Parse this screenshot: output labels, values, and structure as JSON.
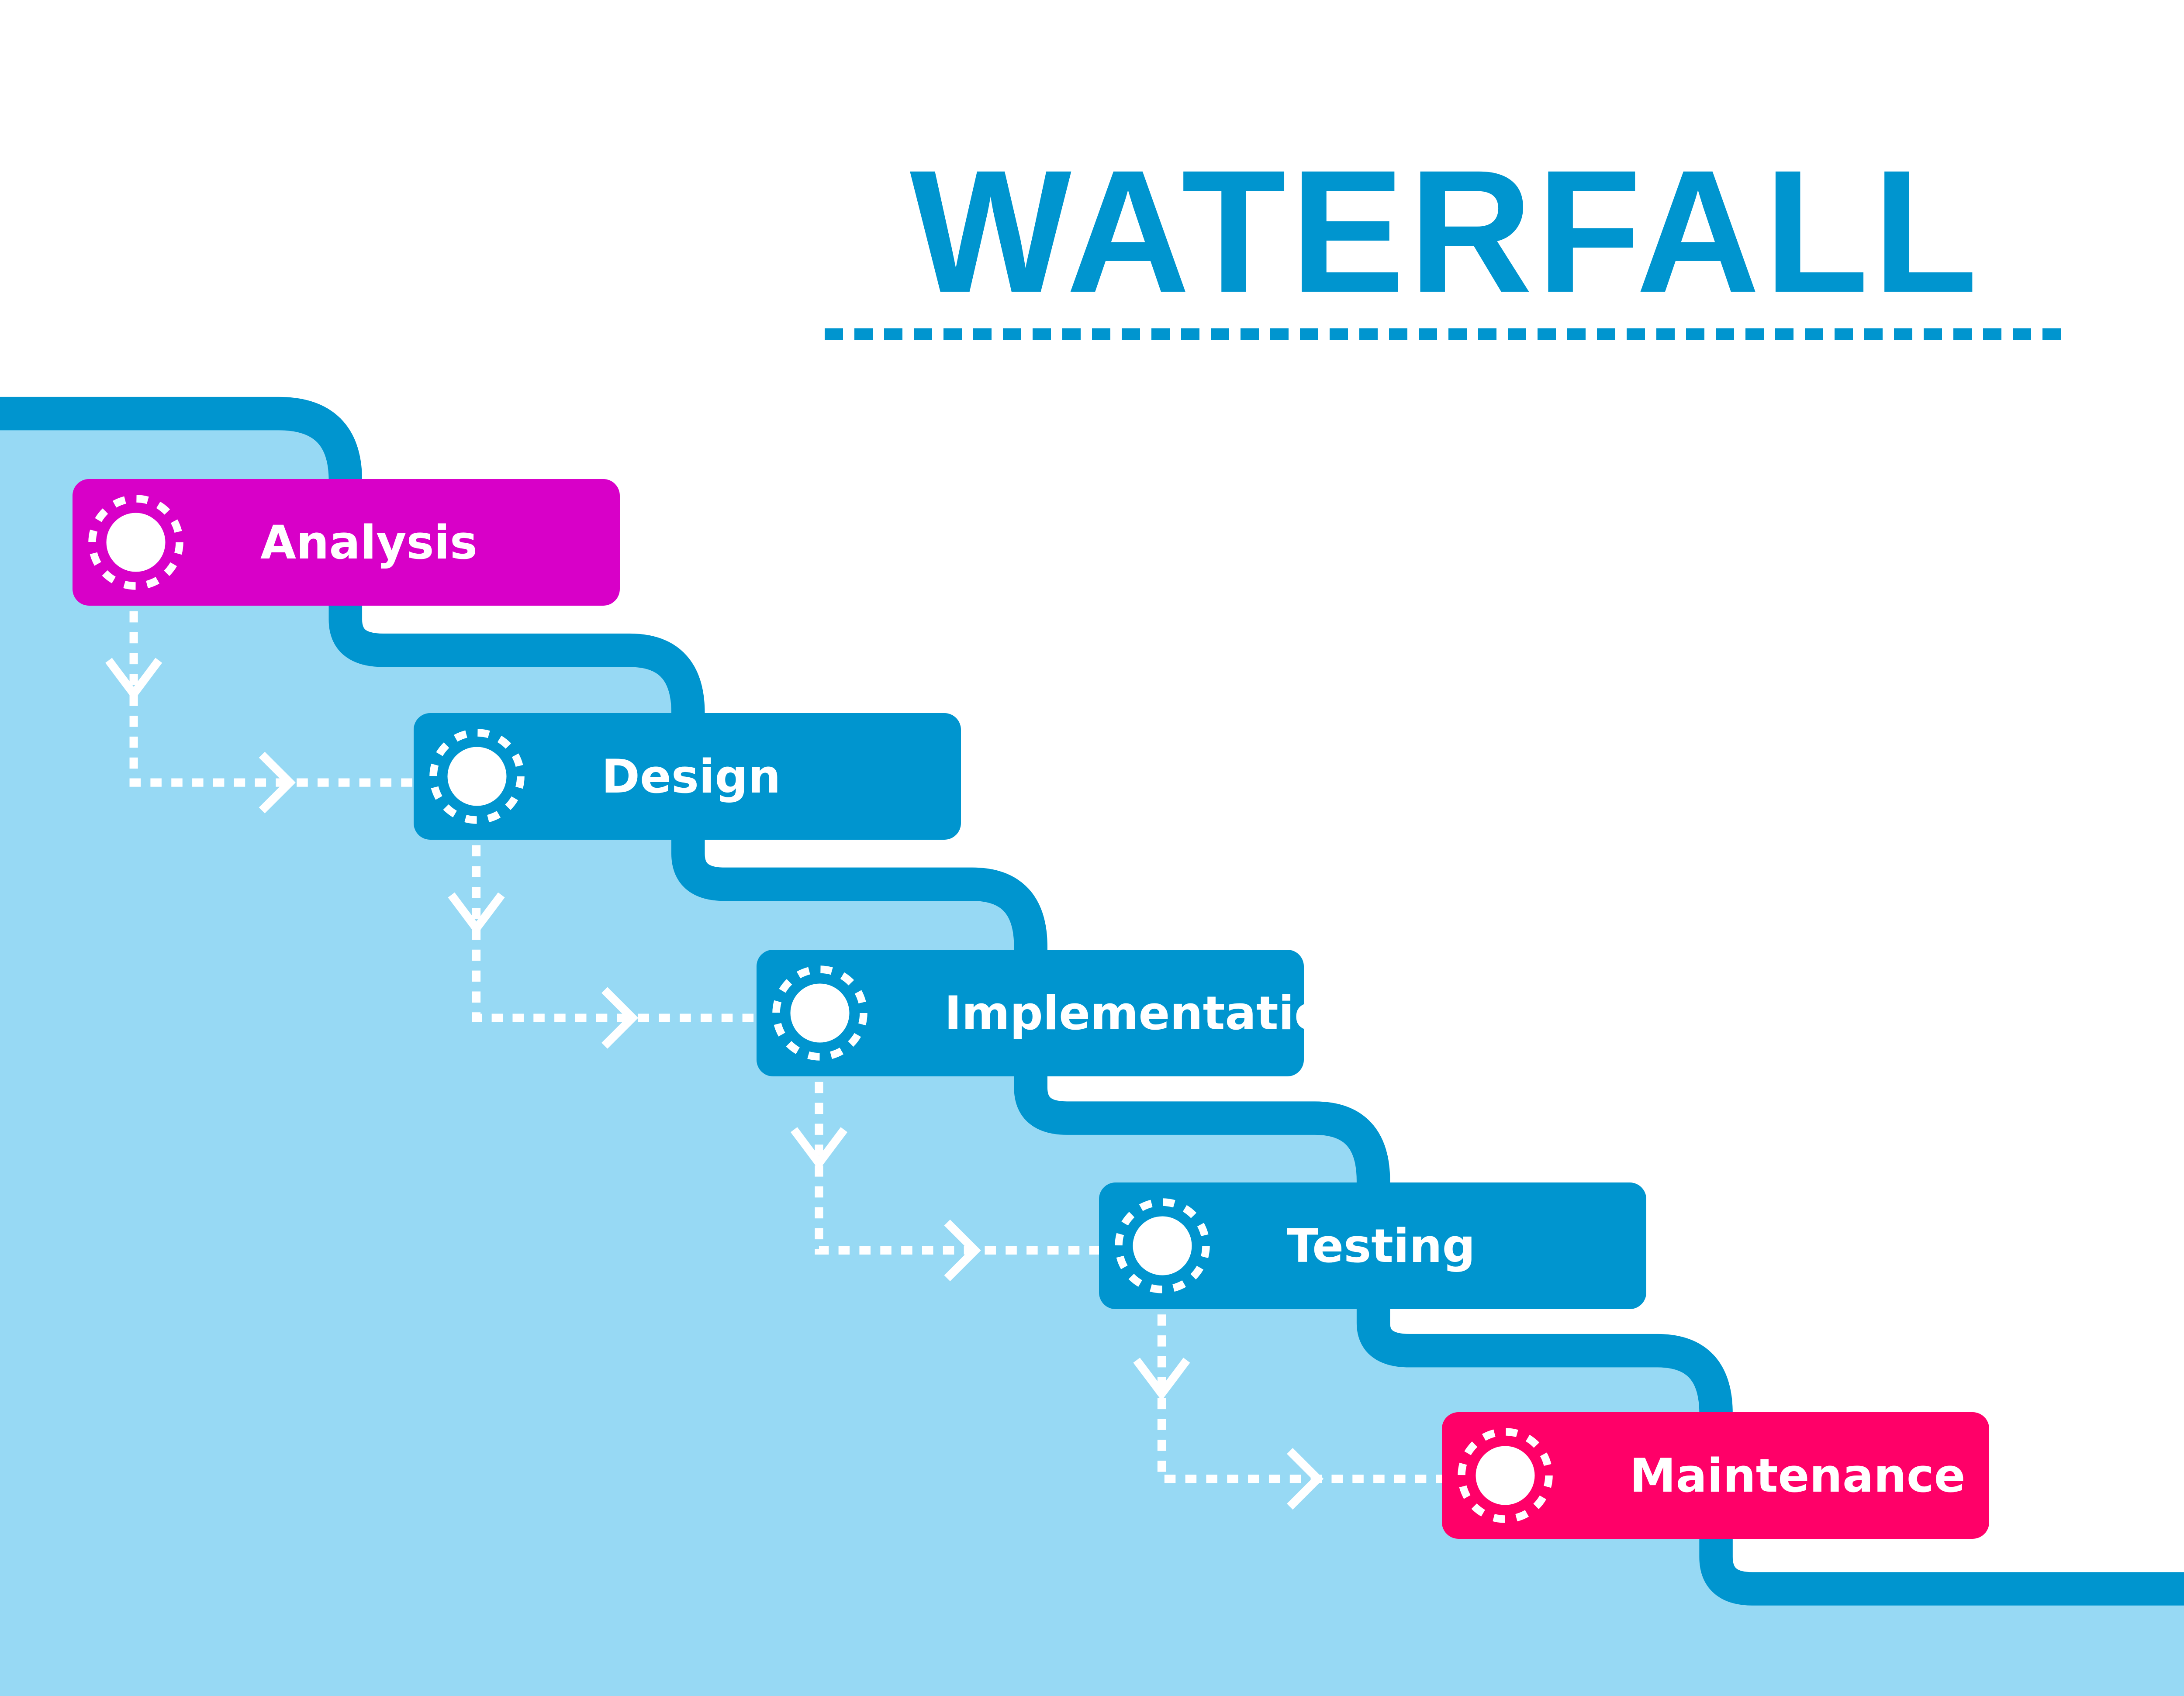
{
  "title": "WATERFALL",
  "colors": {
    "channel": "#0095cf",
    "water": "#97d9f4",
    "background": "#ffffff",
    "text_on_box": "#ffffff"
  },
  "phases": [
    {
      "label": "Analysis",
      "color": "#d800c8",
      "icon": "gear-icon"
    },
    {
      "label": "Design",
      "color": "#0095cf",
      "icon": "gear-icon"
    },
    {
      "label": "Implementation",
      "color": "#0095cf",
      "icon": "gear-icon"
    },
    {
      "label": "Testing",
      "color": "#0095cf",
      "icon": "gear-icon"
    },
    {
      "label": "Maintenance",
      "color": "#ff0068",
      "icon": "gear-icon"
    }
  ],
  "connectors": [
    {
      "from": "Analysis",
      "to": "Design",
      "style": "dotted-arrow"
    },
    {
      "from": "Design",
      "to": "Implementation",
      "style": "dotted-arrow"
    },
    {
      "from": "Implementation",
      "to": "Testing",
      "style": "dotted-arrow"
    },
    {
      "from": "Testing",
      "to": "Maintenance",
      "style": "dotted-arrow"
    }
  ]
}
